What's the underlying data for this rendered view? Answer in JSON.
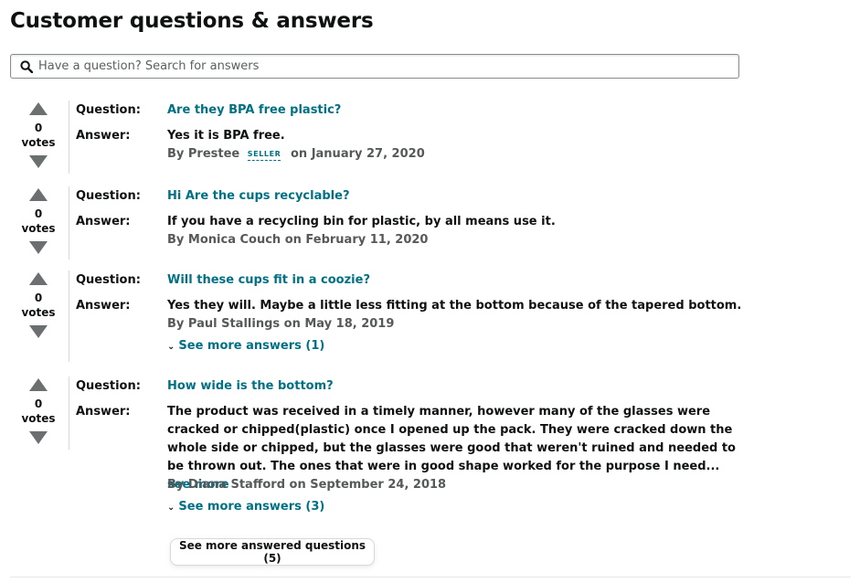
{
  "header": {
    "title": "Customer questions & answers"
  },
  "search": {
    "placeholder": "Have a question? Search for answers",
    "icon": "search-icon"
  },
  "labels": {
    "question": "Question:",
    "answer": "Answer:",
    "votes": "votes",
    "seller_badge": "SELLER"
  },
  "questions": [
    {
      "votes": "0",
      "question": "Are they BPA free plastic?",
      "answer": "Yes it is BPA free.",
      "by_prefix": "By Prestee",
      "seller": true,
      "date_text": "on January 27, 2020"
    },
    {
      "votes": "0",
      "question": "Hi Are the cups recyclable?",
      "answer": "If you have a recycling bin for plastic, by all means use it.",
      "byline": "By Monica Couch on February 11, 2020"
    },
    {
      "votes": "0",
      "question": "Will these cups fit in a coozie?",
      "answer": "Yes they will. Maybe a little less fitting at the bottom because of the tapered bottom.",
      "byline": "By Paul Stallings on May 18, 2019",
      "see_more_answers": "See more answers (1)"
    },
    {
      "votes": "0",
      "question": "How wide is the bottom?",
      "answer": "The product was received in a timely manner, however many of the glasses were cracked or chipped(plastic) once I opened up the pack. They were cracked down the whole side or chipped, but the glasses were good that weren't ruined and needed to be thrown out. The ones that were in good shape worked for the purpose I need...",
      "answer_see_more": "see more",
      "byline": "By Diana Stafford on September 24, 2018",
      "see_more_answers": "See more answers (3)"
    }
  ],
  "footer": {
    "more_questions_button": "See more answered questions (5)"
  }
}
